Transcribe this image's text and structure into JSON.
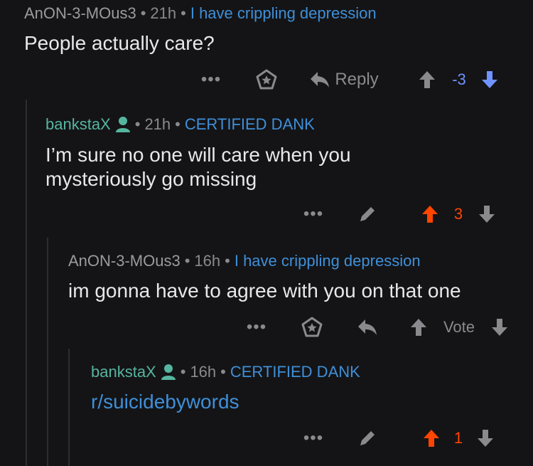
{
  "comments": [
    {
      "user": "AnON-3-MOus3",
      "time": "21h",
      "flair": "I have crippling depression",
      "body": "People actually care?",
      "actions": {
        "more": "•••",
        "reply": "Reply",
        "score": "-3",
        "vote_state": "down"
      }
    },
    {
      "user": "bankstaX",
      "time": "21h",
      "flair": "CERTIFIED DANK",
      "body_lines": [
        "I’m sure no one will care when you",
        "mysteriously go missing"
      ],
      "actions": {
        "more": "•••",
        "score": "3",
        "vote_state": "up"
      }
    },
    {
      "user": "AnON-3-MOus3",
      "time": "16h",
      "flair": "I have crippling depression",
      "body": "im gonna have to agree with you on that one",
      "actions": {
        "more": "•••",
        "vote": "Vote"
      }
    },
    {
      "user": "bankstaX",
      "time": "16h",
      "flair": "CERTIFIED DANK",
      "body": "r/suicidebywords",
      "actions": {
        "more": "•••",
        "score": "1",
        "vote_state": "up"
      }
    }
  ],
  "colors": {
    "background": "#141416",
    "upvote": "#ff4500",
    "downvote": "#7193ff",
    "flair": "#3f8fd8",
    "op_green": "#56b5a0"
  },
  "icons": [
    "more-icon",
    "award-icon",
    "reply-icon",
    "upvote-icon",
    "downvote-icon",
    "edit-icon",
    "person-icon"
  ]
}
